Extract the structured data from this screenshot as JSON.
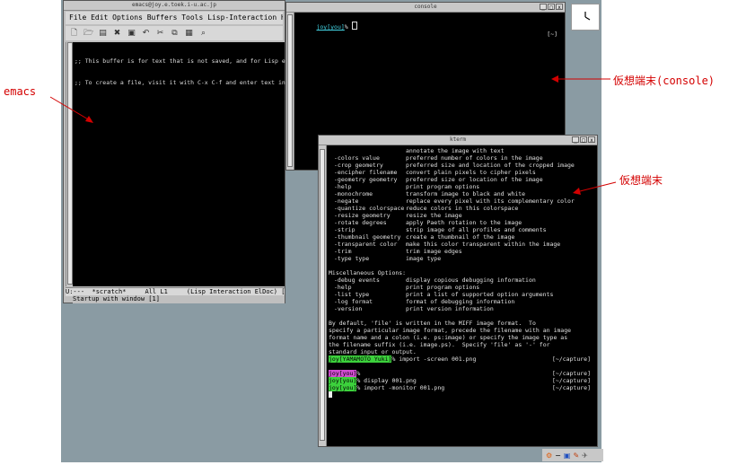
{
  "labels": {
    "emacs": "emacs",
    "console": "仮想端末(console)",
    "terminal": "仮想端末"
  },
  "emacs_window": {
    "title": "emacs@joy.e.toek.i-u.ac.jp",
    "menu": "File Edit Options Buffers Tools Lisp-Interaction Help",
    "toolbar_icons": [
      "new-file-icon",
      "open-folder-icon",
      "save-icon",
      "close-icon",
      "save-as-icon",
      "undo-icon",
      "cut-icon",
      "copy-icon",
      "paste-icon",
      "search-icon"
    ],
    "buffer_lines": [
      ";; This buffer is for text that is not saved, and for Lisp eva",
      ";; To create a file, visit it with C-x C-f and enter text in i"
    ],
    "mode_line": "U:---  *scratch*     All L1     (Lisp Interaction ElDoc) [1]",
    "echo_area": "Startup with window [1]"
  },
  "console_window": {
    "title": "console",
    "prompt_user": "joy[you]",
    "prompt_symbol": "% ",
    "cwd": "[~]"
  },
  "terminal_window": {
    "title": "kterm",
    "top_line": "annotate the image with text",
    "options": [
      [
        "-colors value",
        "preferred number of colors in the image"
      ],
      [
        "-crop geometry",
        "preferred size and location of the cropped image"
      ],
      [
        "-encipher filename",
        "convert plain pixels to cipher pixels"
      ],
      [
        "-geometry geometry",
        "preferred size or location of the image"
      ],
      [
        "-help",
        "print program options"
      ],
      [
        "-monochrome",
        "transform image to black and white"
      ],
      [
        "-negate",
        "replace every pixel with its complementary color"
      ],
      [
        "-quantize colorspace",
        "reduce colors in this colorspace"
      ],
      [
        "-resize geometry",
        "resize the image"
      ],
      [
        "-rotate degrees",
        "apply Paeth rotation to the image"
      ],
      [
        "-strip",
        "strip image of all profiles and comments"
      ],
      [
        "-thumbnail geometry",
        "create a thumbnail of the image"
      ],
      [
        "-transparent color",
        "make this color transparent within the image"
      ],
      [
        "-trim",
        "trim image edges"
      ],
      [
        "-type type",
        "image type"
      ]
    ],
    "misc_header": "Miscellaneous Options:",
    "misc_options": [
      [
        "-debug events",
        "display copious debugging information"
      ],
      [
        "-help",
        "print program options"
      ],
      [
        "-list type",
        "print a list of supported option arguments"
      ],
      [
        "-log format",
        "format of debugging information"
      ],
      [
        "-version",
        "print version information"
      ]
    ],
    "paragraph": [
      "By default, 'file' is written in the MIFF image format.  To",
      "specify a particular image format, precede the filename with an image",
      "format name and a colon (i.e. ps:image) or specify the image type as",
      "the filename suffix (i.e. image.ps).  Specify 'file' as '-' for",
      "standard input or output."
    ],
    "history": [
      {
        "user": "joy[YAMAMOTO Yuki]",
        "sym": "% ",
        "cmd": "import -screen 001.png",
        "cwd": "[~/capture]",
        "color": "green"
      },
      {
        "user": "joy[you]",
        "sym": "% ",
        "cmd": "",
        "cwd": "[~/capture]",
        "color": "magenta"
      },
      {
        "user": "joy[you]",
        "sym": "% ",
        "cmd": "display 001.png",
        "cwd": "[~/capture]",
        "color": "green"
      },
      {
        "user": "joy[you]",
        "sym": "% ",
        "cmd": "import -monitor 001.png",
        "cwd": "[~/capture]",
        "color": "green"
      }
    ]
  },
  "tray": {
    "icons": [
      "settings-icon",
      "minus-icon",
      "network-icon",
      "edit-icon",
      "bird-icon"
    ]
  }
}
